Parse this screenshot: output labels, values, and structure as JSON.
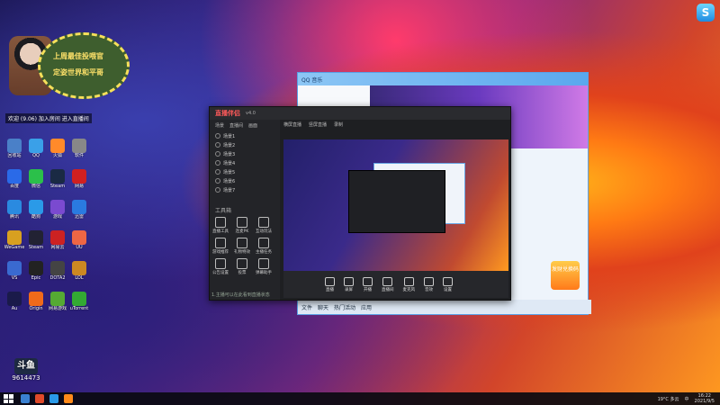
{
  "desktop": {
    "icons": [
      {
        "label": "回收站",
        "color": "#4a80c8"
      },
      {
        "label": "QQ",
        "color": "#3aa0e8"
      },
      {
        "label": "火狐",
        "color": "#ff8a2a"
      },
      {
        "label": "软件",
        "color": "#888"
      },
      {
        "label": "百度",
        "color": "#2a6ae8"
      },
      {
        "label": "微信",
        "color": "#2bc04a"
      },
      {
        "label": "Steam",
        "color": "#1a2a44"
      },
      {
        "label": "网易",
        "color": "#d02020"
      },
      {
        "label": "腾讯",
        "color": "#2a8ae0"
      },
      {
        "label": "酷狗",
        "color": "#2a9ae8"
      },
      {
        "label": "游戏",
        "color": "#7a4ad0"
      },
      {
        "label": "迅雷",
        "color": "#2a7ae0"
      },
      {
        "label": "WeGame",
        "color": "#d8a020"
      },
      {
        "label": "Steam",
        "color": "#223"
      },
      {
        "label": "网易云",
        "color": "#c22"
      },
      {
        "label": "UU",
        "color": "#e64"
      },
      {
        "label": "VS",
        "color": "#3a6ad0"
      },
      {
        "label": "Epic",
        "color": "#222"
      },
      {
        "label": "DOTA2",
        "color": "#444"
      },
      {
        "label": "LOL",
        "color": "#c82"
      },
      {
        "label": "Au",
        "color": "#1a1a4a"
      },
      {
        "label": "Origin",
        "color": "#f06a1a"
      },
      {
        "label": "网易游戏",
        "color": "#5a3"
      },
      {
        "label": "uTorrent",
        "color": "#3a3"
      }
    ],
    "banner_line1": "上周最佳投喂官",
    "banner_line2": "定姿世界和平哥",
    "notice": "欢迎 (9.06) 加入房间 进入直播间",
    "corner_logo": "S"
  },
  "qq_window": {
    "title": "QQ 音乐",
    "bottom_items": [
      "文件",
      "聊天",
      "热门活动",
      "应用"
    ],
    "promo": "发财兑换码"
  },
  "obs": {
    "app_name": "直播伴侣",
    "version": "v4.0",
    "tabs": [
      "场景",
      "直播间",
      "画面",
      "设置"
    ],
    "top_tabs": [
      "横屏直播",
      "竖屏直播",
      "录制"
    ],
    "scenes": [
      "场景1",
      "场景2",
      "场景3",
      "场景4",
      "场景5",
      "场景6",
      "场景7"
    ],
    "tools_header": "工具箱",
    "tools": [
      "直播工具",
      "连麦PK",
      "互动玩法",
      "游戏推荐",
      "礼物特效",
      "主播任务",
      "公告设置",
      "投票",
      "弹幕助手"
    ],
    "toolbar": [
      "直播",
      "录屏",
      "开播",
      "直播间",
      "麦克风",
      "音效",
      "设置"
    ],
    "status": "1.主播可以在此看到直播状态"
  },
  "room_id": "9614473",
  "room_logo": "斗鱼",
  "taskbar": {
    "temp": "19°C 多云",
    "time": "16:22",
    "date": "2021/9/5",
    "lang": "中"
  }
}
